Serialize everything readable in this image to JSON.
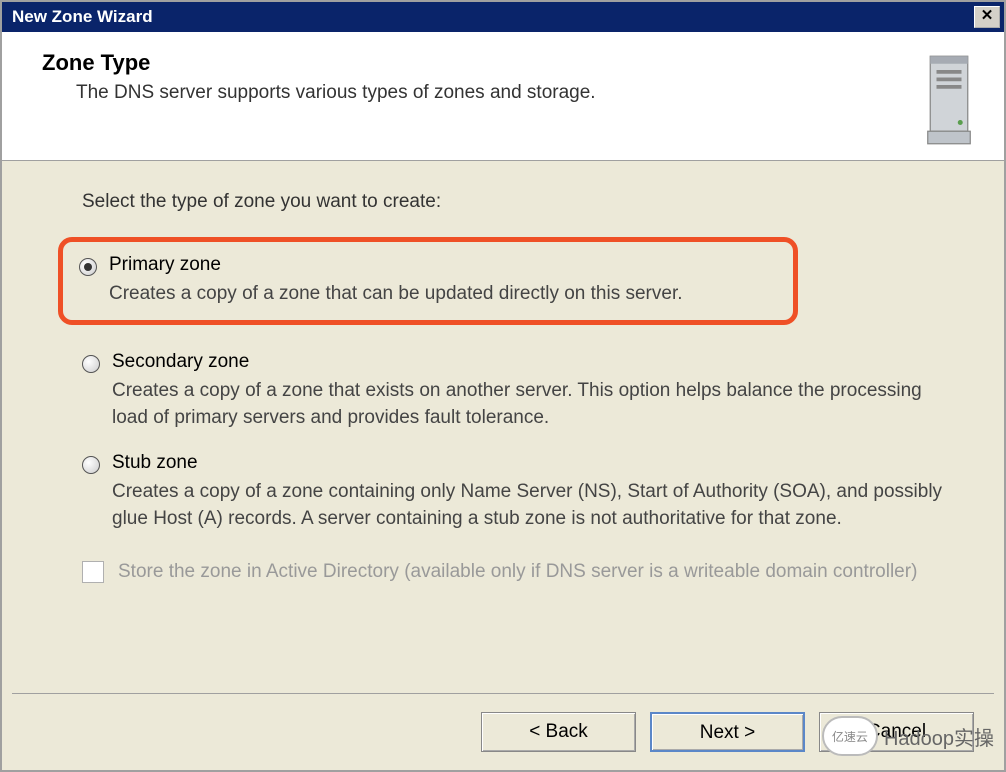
{
  "window": {
    "title": "New Zone Wizard"
  },
  "header": {
    "title": "Zone Type",
    "subtitle": "The DNS server supports various types of zones and storage."
  },
  "content": {
    "instruction": "Select the type of zone you want to create:",
    "options": [
      {
        "label": "Primary zone",
        "description": "Creates a copy of a zone that can be updated directly on this server.",
        "selected": true,
        "highlighted": true
      },
      {
        "label": "Secondary zone",
        "description": "Creates a copy of a zone that exists on another server. This option helps balance the processing load of primary servers and provides fault tolerance.",
        "selected": false,
        "highlighted": false
      },
      {
        "label": "Stub zone",
        "description": "Creates a copy of a zone containing only Name Server (NS), Start of Authority (SOA), and possibly glue Host (A) records. A server containing a stub zone is not authoritative for that zone.",
        "selected": false,
        "highlighted": false
      }
    ],
    "checkbox": {
      "label": "Store the zone in Active Directory (available only if DNS server is a writeable domain controller)",
      "enabled": false,
      "checked": false
    }
  },
  "buttons": {
    "back": "< Back",
    "next": "Next >",
    "cancel": "Cancel"
  },
  "watermark": {
    "logo_text": "亿速云",
    "text": "Hadoop实操"
  }
}
